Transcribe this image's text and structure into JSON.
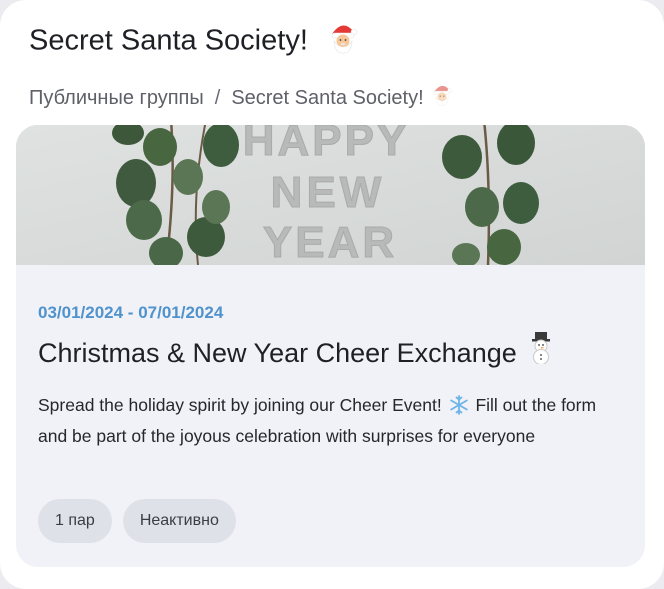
{
  "header": {
    "title": "Secret Santa Society!",
    "title_icon": "santa-emoji-icon"
  },
  "breadcrumb": {
    "items": [
      "Публичные группы",
      "Secret Santa Society!"
    ],
    "separator": "/",
    "last_icon": "santa-emoji-icon"
  },
  "event": {
    "banner": {
      "text_lines": [
        "HAPPY",
        "NEW",
        "YEAR"
      ],
      "icon": "eucalyptus-branches"
    },
    "dates": "03/01/2024 - 07/01/2024",
    "title": "Christmas & New Year Cheer Exchange",
    "title_icon": "snowman-emoji-icon",
    "description_part1": "Spread the holiday spirit by joining our Cheer Event!",
    "description_icon": "snowflake-emoji-icon",
    "description_part2": "Fill out the form and be part of the joyous celebration with surprises for everyone",
    "chips": [
      "1 пар",
      "Неактивно"
    ]
  },
  "colors": {
    "accent_dates": "#4f92cc",
    "card_bg": "#f1f2f7",
    "chip_bg": "#dfe1e8"
  }
}
